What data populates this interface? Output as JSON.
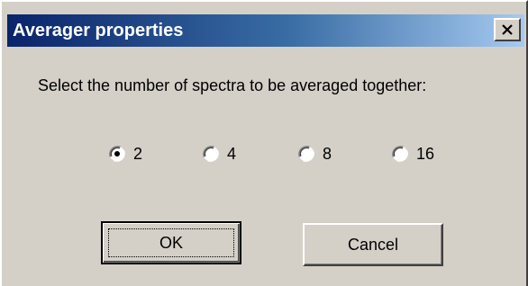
{
  "window": {
    "title": "Averager properties"
  },
  "dialog": {
    "prompt": "Select the number of spectra to be averaged together:",
    "options": [
      {
        "label": "2",
        "selected": true
      },
      {
        "label": "4",
        "selected": false
      },
      {
        "label": "8",
        "selected": false
      },
      {
        "label": "16",
        "selected": false
      }
    ],
    "ok_label": "OK",
    "cancel_label": "Cancel"
  },
  "colors": {
    "title_active": "#0a246a",
    "title_gradient_end": "#a6caf0",
    "face": "#d4d0c8"
  },
  "icons": {
    "close": "close-icon"
  }
}
